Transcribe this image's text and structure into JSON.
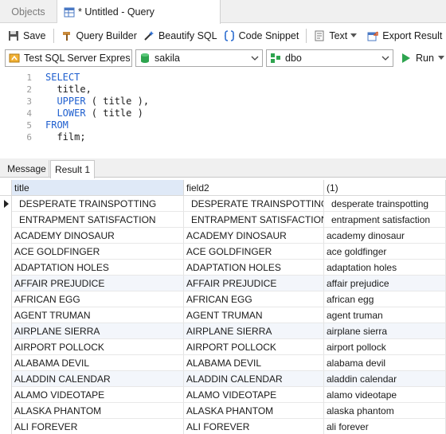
{
  "tabs": {
    "objects": "Objects",
    "query": "* Untitled - Query"
  },
  "toolbar": {
    "save": "Save",
    "query_builder": "Query Builder",
    "beautify": "Beautify SQL",
    "snippet": "Code Snippet",
    "text": "Text",
    "export": "Export Result"
  },
  "connection": {
    "server": "Test SQL Server Expres",
    "database": "sakila",
    "schema": "dbo",
    "run": "Run"
  },
  "editor": {
    "line_numbers": [
      "1",
      "2",
      "3",
      "4",
      "5",
      "6"
    ],
    "l1_kw": "SELECT",
    "l2": "  title,",
    "l3_kw": "  UPPER",
    "l3_rest": " ( title ),",
    "l4_kw": "  LOWER",
    "l4_rest": " ( title )",
    "l5_kw": "FROM",
    "l6": "  film;"
  },
  "result_tabs": {
    "message": "Message",
    "result": "Result 1"
  },
  "grid": {
    "columns": [
      "title",
      "field2",
      "(1)"
    ],
    "rows": [
      [
        "DESPERATE TRAINSPOTTING",
        "DESPERATE TRAINSPOTTING",
        "desperate trainspotting"
      ],
      [
        "ENTRAPMENT SATISFACTION",
        "ENTRAPMENT SATISFACTION",
        "entrapment satisfaction"
      ],
      [
        "ACADEMY DINOSAUR",
        "ACADEMY DINOSAUR",
        "academy dinosaur"
      ],
      [
        "ACE GOLDFINGER",
        "ACE GOLDFINGER",
        "ace goldfinger"
      ],
      [
        "ADAPTATION HOLES",
        "ADAPTATION HOLES",
        "adaptation holes"
      ],
      [
        "AFFAIR PREJUDICE",
        "AFFAIR PREJUDICE",
        "affair prejudice"
      ],
      [
        "AFRICAN EGG",
        "AFRICAN EGG",
        "african egg"
      ],
      [
        "AGENT TRUMAN",
        "AGENT TRUMAN",
        "agent truman"
      ],
      [
        "AIRPLANE SIERRA",
        "AIRPLANE SIERRA",
        "airplane sierra"
      ],
      [
        "AIRPORT POLLOCK",
        "AIRPORT POLLOCK",
        "airport pollock"
      ],
      [
        "ALABAMA DEVIL",
        "ALABAMA DEVIL",
        "alabama devil"
      ],
      [
        "ALADDIN CALENDAR",
        "ALADDIN CALENDAR",
        "aladdin calendar"
      ],
      [
        "ALAMO VIDEOTAPE",
        "ALAMO VIDEOTAPE",
        "alamo videotape"
      ],
      [
        "ALASKA PHANTOM",
        "ALASKA PHANTOM",
        "alaska phantom"
      ],
      [
        "ALI FOREVER",
        "ALI FOREVER",
        "ali forever"
      ]
    ]
  }
}
